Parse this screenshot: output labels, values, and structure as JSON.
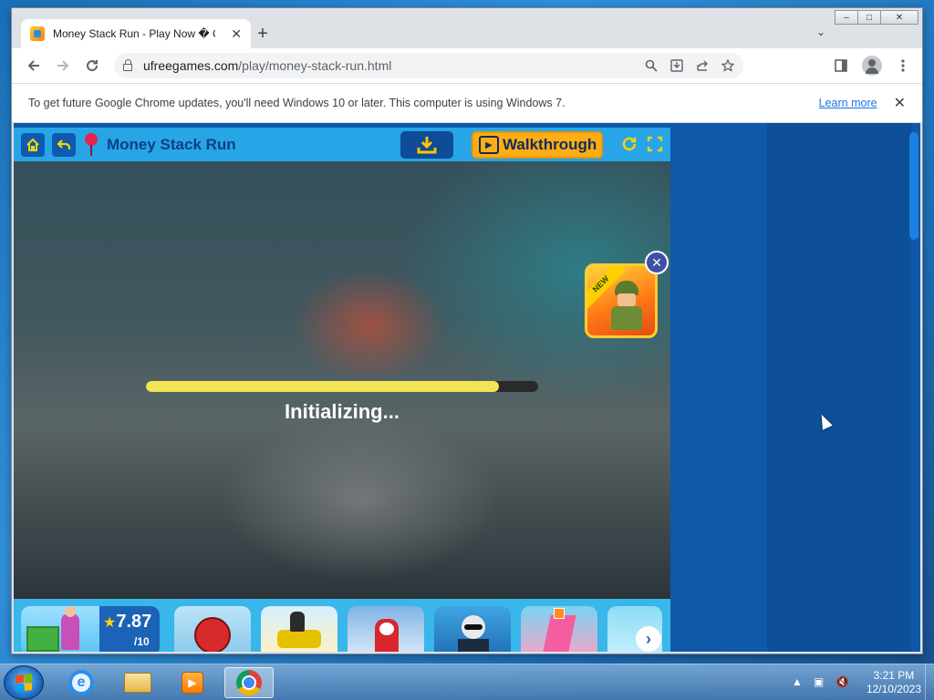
{
  "browser": {
    "tab_title": "Money Stack Run - Play Now � C",
    "tab_close": "✕",
    "new_tab": "+",
    "tab_search": "⌄",
    "url_domain": "ufreegames.com",
    "url_path": "/play/money-stack-run.html",
    "window_controls": [
      "–",
      "□",
      "✕"
    ]
  },
  "infobar": {
    "message": "To get future Google Chrome updates, you'll need Windows 10 or later. This computer is using Windows 7.",
    "learn_more": "Learn more",
    "close": "✕"
  },
  "game": {
    "title": "Money Stack Run",
    "walkthrough_label": "Walkthrough",
    "loading_text": "Initializing...",
    "loading_progress": 0.9,
    "promo_ribbon": "NEW",
    "promo_close": "✕",
    "rating": "7.87",
    "rating_scale": "/10",
    "next_arrow": "›"
  },
  "taskbar": {
    "time": "3:21 PM",
    "date": "12/10/2023",
    "apps": [
      "internet-explorer",
      "file-explorer",
      "media-player",
      "google-chrome"
    ],
    "active_app": "google-chrome"
  },
  "colors": {
    "game_header": "#27a5e6",
    "progress_fill": "#f2e457",
    "walkthrough_button": "#ffad14",
    "page_background": "#0f59a8"
  }
}
